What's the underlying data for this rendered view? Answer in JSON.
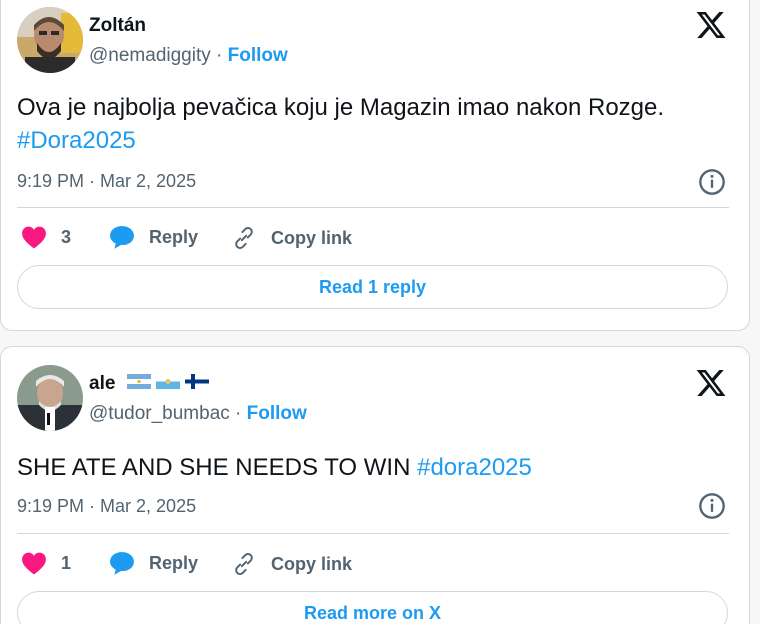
{
  "tweets": [
    {
      "name": "Zoltán",
      "handle": "@nemadiggity",
      "separator": "·",
      "follow_label": "Follow",
      "text": "Ova je najbolja pevačica koju je Magazin imao nakon Rozge.",
      "hashtag": "#Dora2025",
      "timestamp": "9:19 PM · Mar 2, 2025",
      "like_count": "3",
      "reply_label": "Reply",
      "copy_link_label": "Copy link",
      "button_label": "Read 1 reply"
    },
    {
      "name": "ale",
      "handle": "@tudor_bumbac",
      "separator": "·",
      "follow_label": "Follow",
      "text": "SHE ATE AND SHE NEEDS TO WIN",
      "hashtag": "#dora2025",
      "timestamp": "9:19 PM · Mar 2, 2025",
      "like_count": "1",
      "reply_label": "Reply",
      "copy_link_label": "Copy link",
      "button_label": "Read more on X"
    }
  ],
  "colors": {
    "accent": "#1d9bf0",
    "like": "#f91880",
    "text": "#0f1419",
    "muted": "#536471",
    "border": "#cfd9de"
  },
  "icons": {
    "logo": "x-logo-icon",
    "like": "heart-icon",
    "reply": "speech-bubble-icon",
    "copy": "link-icon",
    "info": "info-icon",
    "flags": [
      "argentina-flag-icon",
      "san-marino-flag-icon",
      "finland-flag-icon"
    ]
  }
}
